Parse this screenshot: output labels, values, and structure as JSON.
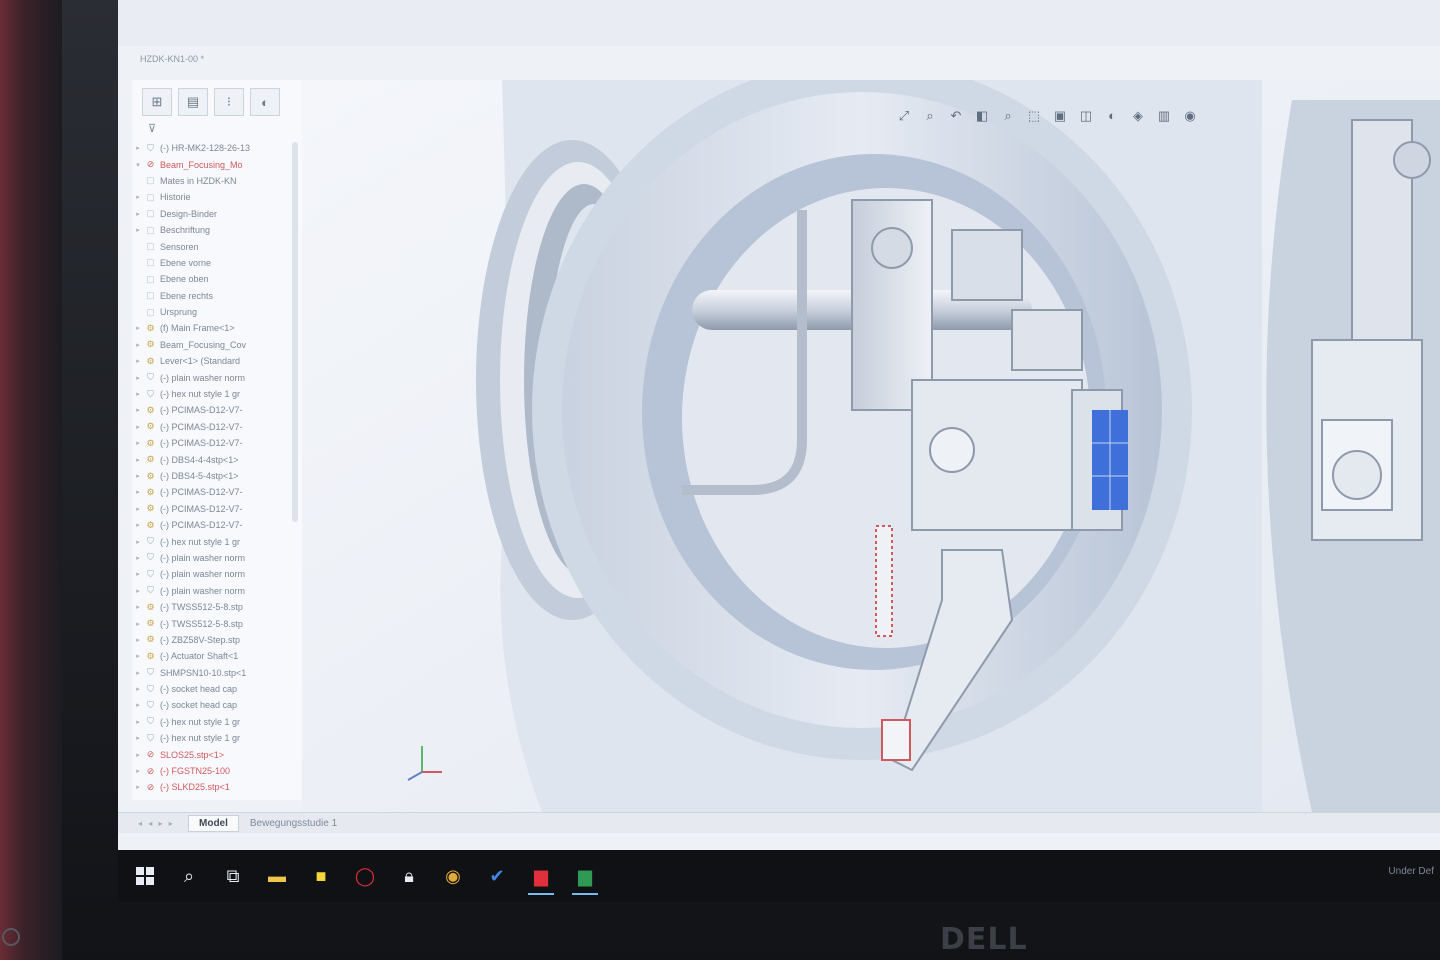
{
  "window": {
    "menu_line": "",
    "doc_tab": "HZDK-KN1-00 *"
  },
  "tree": {
    "filter_icon": "filter-icon",
    "items": [
      {
        "label": "(-) HR-MK2-128-26-13",
        "kind": "part",
        "expand": "▸"
      },
      {
        "label": "Beam_Focusing_Mo",
        "kind": "red",
        "expand": "▾"
      },
      {
        "label": "Mates in HZDK-KN",
        "kind": "folder",
        "expand": ""
      },
      {
        "label": "Historie",
        "kind": "folder",
        "expand": "▸"
      },
      {
        "label": "Design-Binder",
        "kind": "folder",
        "expand": "▸"
      },
      {
        "label": "Beschriftung",
        "kind": "folder",
        "expand": "▸"
      },
      {
        "label": "Sensoren",
        "kind": "folder",
        "expand": ""
      },
      {
        "label": "Ebene vorne",
        "kind": "folder",
        "expand": ""
      },
      {
        "label": "Ebene oben",
        "kind": "folder",
        "expand": ""
      },
      {
        "label": "Ebene rechts",
        "kind": "folder",
        "expand": ""
      },
      {
        "label": "Ursprung",
        "kind": "folder",
        "expand": ""
      },
      {
        "label": "(f) Main Frame<1>",
        "kind": "assy",
        "expand": "▸"
      },
      {
        "label": "Beam_Focusing_Cov",
        "kind": "assy",
        "expand": "▸"
      },
      {
        "label": "Lever<1> (Standard",
        "kind": "assy",
        "expand": "▸"
      },
      {
        "label": "(-) plain washer norm",
        "kind": "part",
        "expand": "▸"
      },
      {
        "label": "(-) hex nut style 1 gr",
        "kind": "part",
        "expand": "▸"
      },
      {
        "label": "(-) PCIMAS-D12-V7-",
        "kind": "assy",
        "expand": "▸"
      },
      {
        "label": "(-) PCIMAS-D12-V7-",
        "kind": "assy",
        "expand": "▸"
      },
      {
        "label": "(-) PCIMAS-D12-V7-",
        "kind": "assy",
        "expand": "▸"
      },
      {
        "label": "(-) DBS4-4-4stp<1>",
        "kind": "assy",
        "expand": "▸"
      },
      {
        "label": "(-) DBS4-5-4stp<1>",
        "kind": "assy",
        "expand": "▸"
      },
      {
        "label": "(-) PCIMAS-D12-V7-",
        "kind": "assy",
        "expand": "▸"
      },
      {
        "label": "(-) PCIMAS-D12-V7-",
        "kind": "assy",
        "expand": "▸"
      },
      {
        "label": "(-) PCIMAS-D12-V7-",
        "kind": "assy",
        "expand": "▸"
      },
      {
        "label": "(-) hex nut style 1 gr",
        "kind": "part",
        "expand": "▸"
      },
      {
        "label": "(-) plain washer norm",
        "kind": "part",
        "expand": "▸"
      },
      {
        "label": "(-) plain washer norm",
        "kind": "part",
        "expand": "▸"
      },
      {
        "label": "(-) plain washer norm",
        "kind": "part",
        "expand": "▸"
      },
      {
        "label": "(-) TWSS512-5-8.stp",
        "kind": "assy",
        "expand": "▸"
      },
      {
        "label": "(-) TWSS512-5-8.stp",
        "kind": "assy",
        "expand": "▸"
      },
      {
        "label": "(-) ZBZ58V-Step.stp",
        "kind": "assy",
        "expand": "▸"
      },
      {
        "label": "(-) Actuator Shaft<1",
        "kind": "assy",
        "expand": "▸"
      },
      {
        "label": "SHMPSN10-10.stp<1",
        "kind": "part",
        "expand": "▸"
      },
      {
        "label": "(-) socket head cap",
        "kind": "part",
        "expand": "▸"
      },
      {
        "label": "(-) socket head cap",
        "kind": "part",
        "expand": "▸"
      },
      {
        "label": "(-) hex nut style 1 gr",
        "kind": "part",
        "expand": "▸"
      },
      {
        "label": "(-) hex nut style 1 gr",
        "kind": "part",
        "expand": "▸"
      },
      {
        "label": "SLOS25.stp<1>",
        "kind": "red",
        "expand": "▸"
      },
      {
        "label": "(-) FGSTN25-100",
        "kind": "red",
        "expand": "▸"
      },
      {
        "label": "(-) SLKD25.stp<1",
        "kind": "red",
        "expand": "▸"
      }
    ]
  },
  "bottom_tabs": {
    "nav": "◂ ◂ ▸ ▸",
    "model": "Model",
    "motion_study": "Bewegungsstudie 1"
  },
  "taskbar": {
    "status": "Under Def"
  },
  "colors": {
    "background": "#eef1f6",
    "part_fill": "#dfe5ee",
    "part_shadow": "#a9b5c7",
    "highlight_red": "#d0595d",
    "sensor_blue": "#3f6fd8"
  },
  "monitor": {
    "brand": "DELL"
  }
}
